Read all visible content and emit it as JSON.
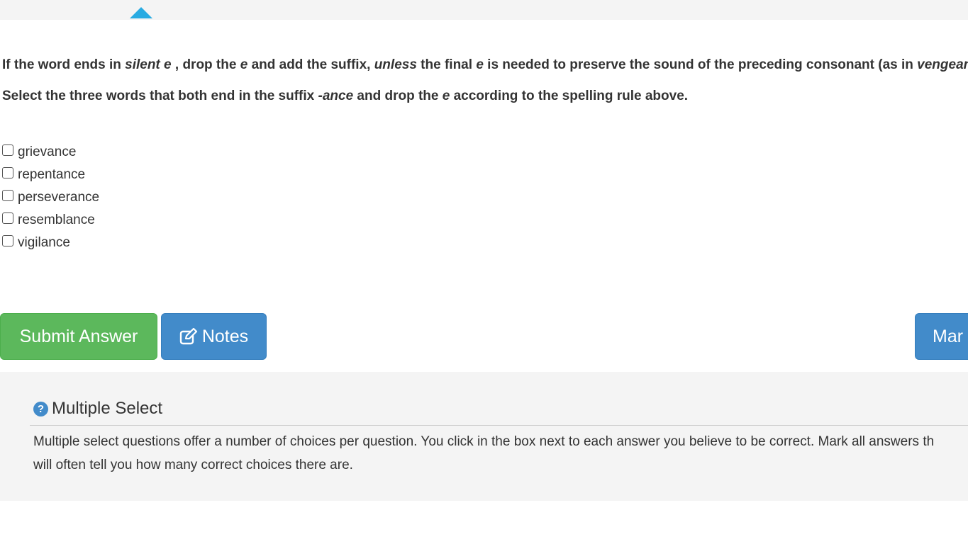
{
  "instructions": {
    "line1": {
      "t1": "If the word ends in ",
      "e1": "silent e",
      "t2": " , drop the ",
      "e2": "e",
      "t3": " and add the suffix, ",
      "e3": "unless",
      "t4": " the final ",
      "e4": "e",
      "t5": " is needed to preserve the sound of the preceding consonant (as in ",
      "e5": "vengeance",
      "t6": " )."
    },
    "line2": {
      "t1": "Select the three words that both end in the suffix ",
      "e1": "-ance",
      "t2": " and drop the ",
      "e2": "e",
      "t3": " according to the spelling rule above."
    }
  },
  "options": [
    {
      "label": "grievance",
      "checked": false
    },
    {
      "label": "repentance",
      "checked": false
    },
    {
      "label": "perseverance",
      "checked": false
    },
    {
      "label": "resemblance",
      "checked": false
    },
    {
      "label": "vigilance",
      "checked": false
    }
  ],
  "buttons": {
    "submit": "Submit Answer",
    "notes": "Notes",
    "mark": "Mar"
  },
  "help": {
    "title": "Multiple Select",
    "icon": "question-circle-icon",
    "text_line1": "Multiple select questions offer a number of choices per question. You click in the box next to each answer you believe to be correct. Mark all answers th",
    "text_line2": "will often tell you how many correct choices there are."
  },
  "colors": {
    "submit": "#5cb85c",
    "primary": "#428bca",
    "accent_triangle": "#29abe2",
    "panel_bg": "#f4f4f4"
  }
}
